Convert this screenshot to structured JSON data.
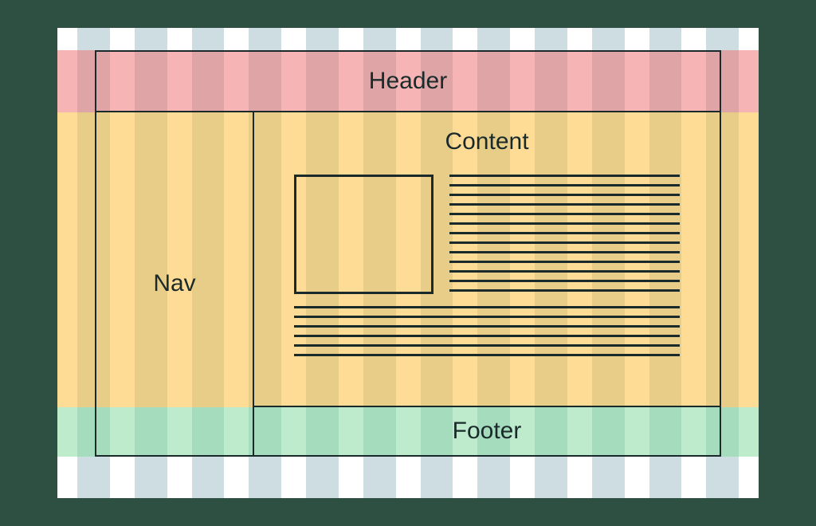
{
  "regions": {
    "header": "Header",
    "nav": "Nav",
    "content": "Content",
    "footer": "Footer"
  },
  "grid": {
    "columns": 12
  }
}
